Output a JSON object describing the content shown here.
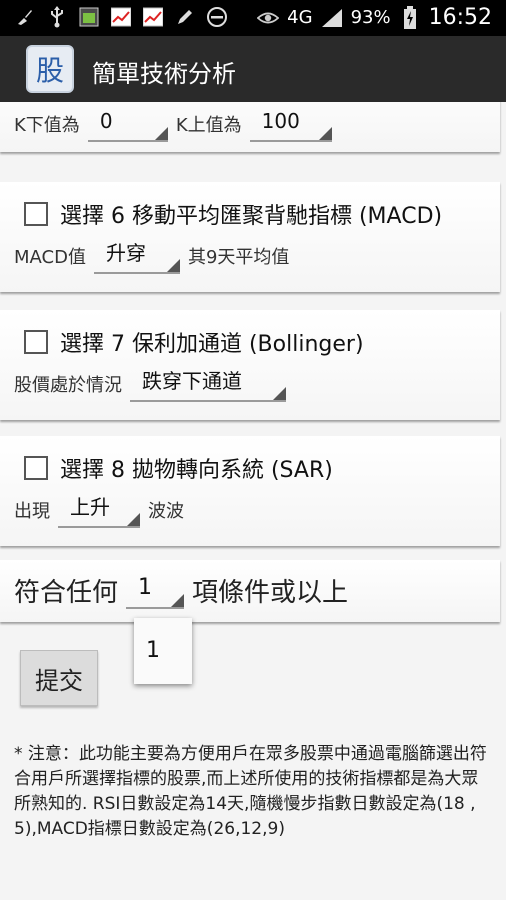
{
  "status_bar": {
    "left_icons": [
      "broom-icon",
      "usb-icon",
      "3g-sim-icon",
      "stock-chart-icon",
      "stock-chart-icon",
      "pencil-icon",
      "blocked-icon"
    ],
    "network": "4G",
    "battery": "93%",
    "time": "16:52"
  },
  "app": {
    "icon_char": "股",
    "title": "簡單技術分析"
  },
  "partial_row": {
    "k_lower_label": "K下值為",
    "k_lower_value": "0",
    "k_upper_label": "K上值為",
    "k_upper_value": "100"
  },
  "macd": {
    "label": "選擇 6 移動平均匯聚背馳指標 (MACD)",
    "prefix": "MACD值",
    "spinner_value": "升穿",
    "suffix": "其9天平均值"
  },
  "bollinger": {
    "label": "選擇 7 保利加通道 (Bollinger)",
    "prefix": "股價處於情況",
    "spinner_value": "跌穿下通道"
  },
  "sar": {
    "label": "選擇 8 拋物轉向系統 (SAR)",
    "prefix": "出現",
    "spinner_value": "上升",
    "suffix": "波波"
  },
  "condition": {
    "prefix": "符合任何",
    "spinner_value": "1",
    "suffix": "項條件或以上",
    "dropdown_options": [
      "1"
    ]
  },
  "submit_label": "提交",
  "note": "* 注意：此功能主要為方便用戶在眾多股票中通過電腦篩選出符合用戶所選擇指標的股票,而上述所使用的技術指標都是為大眾所熟知的. RSI日數設定為14天,隨機慢步指數日數設定為(18 , 5),MACD指標日數設定為(26,12,9)",
  "colors": {
    "status_bar": "#000000",
    "action_bar": "#2a2a2a",
    "background": "#f4f4f4"
  }
}
